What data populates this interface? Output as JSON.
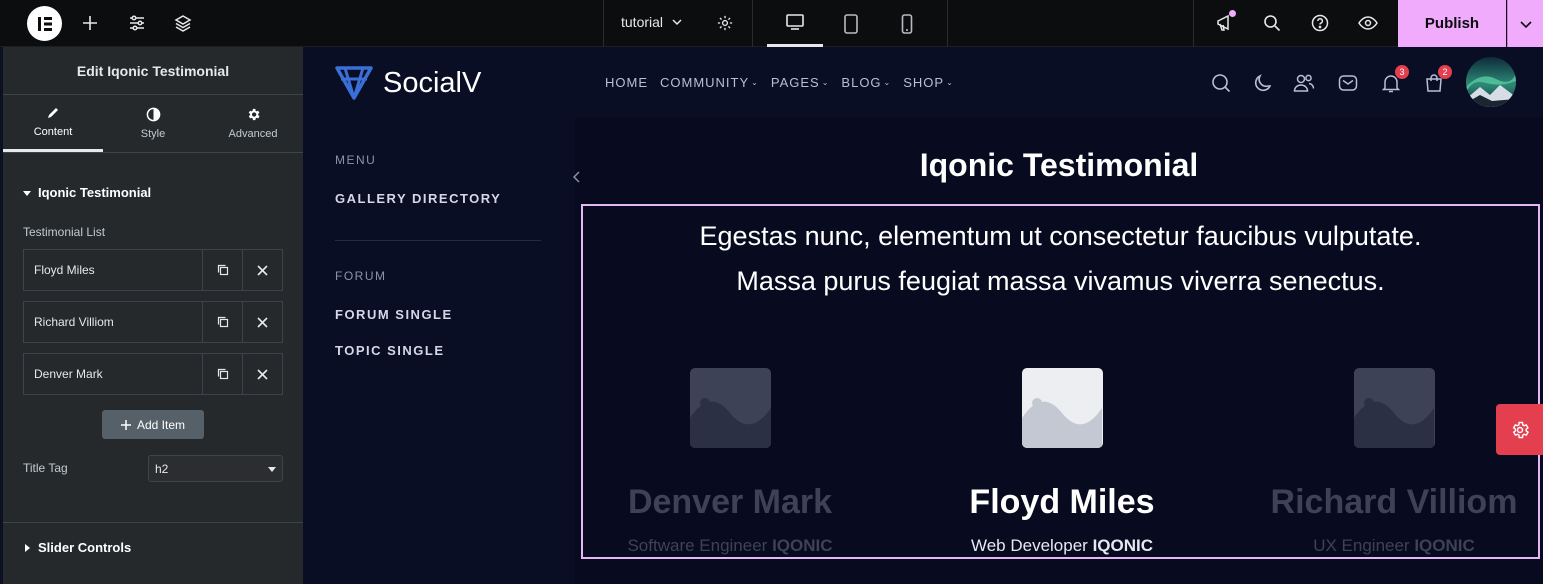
{
  "topbar": {
    "document_name": "tutorial",
    "publish_label": "Publish"
  },
  "panel": {
    "title": "Edit Iqonic Testimonial",
    "tabs": [
      {
        "label": "Content",
        "icon": "pencil-icon"
      },
      {
        "label": "Style",
        "icon": "half-circle-icon"
      },
      {
        "label": "Advanced",
        "icon": "gear-icon"
      }
    ],
    "section_title": "Iqonic Testimonial",
    "list_label": "Testimonial List",
    "items": [
      {
        "name": "Floyd Miles"
      },
      {
        "name": "Richard Villiom"
      },
      {
        "name": "Denver Mark"
      }
    ],
    "add_item_label": "Add Item",
    "title_tag_label": "Title Tag",
    "title_tag_value": "h2",
    "slider_controls_label": "Slider Controls"
  },
  "site": {
    "brand": "SocialV",
    "nav": [
      "HOME",
      "COMMUNITY",
      "PAGES",
      "BLOG",
      "SHOP"
    ],
    "notification_count": "3",
    "cart_count": "2",
    "sidemenu": {
      "menu_heading": "MENU",
      "menu_links": [
        "GALLERY DIRECTORY"
      ],
      "forum_heading": "FORUM",
      "forum_links": [
        "FORUM SINGLE",
        "TOPIC SINGLE"
      ]
    },
    "widget_title": "Iqonic Testimonial",
    "quote_line1": "Egestas nunc, elementum ut consectetur faucibus vulputate.",
    "quote_line2": "Massa purus feugiat massa vivamus viverra senectus.",
    "cards": [
      {
        "name": "Denver Mark",
        "role": "Software Engineer",
        "company": "IQONIC"
      },
      {
        "name": "Floyd Miles",
        "role": "Web Developer",
        "company": "IQONIC"
      },
      {
        "name": "Richard Villiom",
        "role": "UX Engineer",
        "company": "IQONIC"
      }
    ]
  },
  "colors": {
    "publish": "#f0abfc",
    "accent_red": "#e43f4f",
    "brand_blue": "#3b6fd8"
  }
}
